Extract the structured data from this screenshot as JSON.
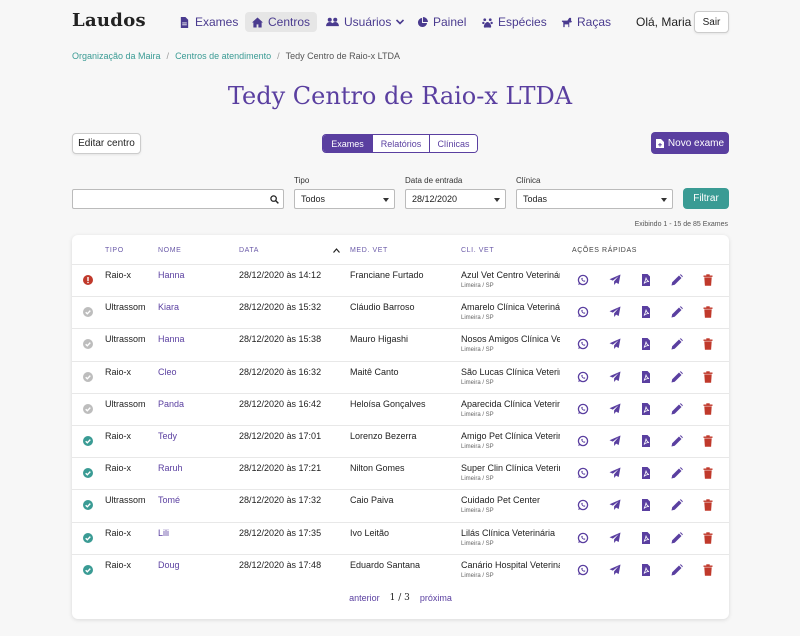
{
  "brand": "Laudos",
  "nav": [
    {
      "label": "Exames",
      "icon": "file-icon"
    },
    {
      "label": "Centros",
      "icon": "home-icon",
      "active": true
    },
    {
      "label": "Usuários",
      "icon": "users-icon",
      "dropdown": true
    },
    {
      "label": "Painel",
      "icon": "chart-pie-icon"
    },
    {
      "label": "Espécies",
      "icon": "paw-icon"
    },
    {
      "label": "Raças",
      "icon": "dog-icon"
    }
  ],
  "greeting": "Olá, Maria",
  "logout_label": "Sair",
  "breadcrumb": {
    "org": "Organização da Maira",
    "centers": "Centros de atendimento",
    "current": "Tedy Centro de Raio-x LTDA"
  },
  "title": "Tedy Centro de Raio-x LTDA",
  "edit_label": "Editar centro",
  "segments": [
    "Exames",
    "Relatórios",
    "Clínicas"
  ],
  "new_exam_label": "Novo exame",
  "filters": {
    "search_value": "",
    "type_label": "Tipo",
    "type_value": "Todos",
    "date_label": "Data de entrada",
    "date_value": "28/12/2020",
    "clinic_label": "Clínica",
    "clinic_value": "Todas",
    "filter_label": "Filtrar"
  },
  "results_count": "Exibindo 1 - 15 de 85 Exames",
  "table": {
    "headers": {
      "type": "TIPO",
      "name": "NOME",
      "date": "DATA",
      "vet": "MED. VET",
      "clinic": "CLI. VET",
      "actions": "AÇÕES RÁPIDAS"
    },
    "rows": [
      {
        "status": "error",
        "type": "Raio-x",
        "name": "Hanna",
        "date": "28/12/2020 às 14:12",
        "vet": "Franciane Furtado",
        "clinic": "Azul Vet Centro Veterinário",
        "location": "Limeira / SP"
      },
      {
        "status": "pending",
        "type": "Ultrassom",
        "name": "Kiara",
        "date": "28/12/2020 às 15:32",
        "vet": "Cláudio Barroso",
        "clinic": "Amarelo Clínica Veterinária",
        "location": "Limeira / SP"
      },
      {
        "status": "pending",
        "type": "Ultrassom",
        "name": "Hanna",
        "date": "28/12/2020 às 15:38",
        "vet": "Mauro Higashi",
        "clinic": "Nosos Amigos Clínica Veterinária",
        "location": "Limeira / SP"
      },
      {
        "status": "pending",
        "type": "Raio-x",
        "name": "Cleo",
        "date": "28/12/2020 às 16:32",
        "vet": "Maitê Canto",
        "clinic": "São Lucas Clínica Veterinária",
        "location": "Limeira / SP"
      },
      {
        "status": "pending",
        "type": "Ultrassom",
        "name": "Panda",
        "date": "28/12/2020 às 16:42",
        "vet": "Heloísa Gonçalves",
        "clinic": "Aparecida Clínica Veterinária",
        "location": "Limeira / SP"
      },
      {
        "status": "done",
        "type": "Raio-x",
        "name": "Tedy",
        "date": "28/12/2020 às 17:01",
        "vet": "Lorenzo Bezerra",
        "clinic": "Amigo Pet Clínica Veterinária",
        "location": "Limeira / SP"
      },
      {
        "status": "done",
        "type": "Raio-x",
        "name": "Raruh",
        "date": "28/12/2020 às 17:21",
        "vet": "Nilton Gomes",
        "clinic": "Super Clin Clínica Veterinária",
        "location": "Limeira / SP"
      },
      {
        "status": "done",
        "type": "Ultrassom",
        "name": "Tomé",
        "date": "28/12/2020 às 17:32",
        "vet": "Caio Paiva",
        "clinic": "Cuidado Pet Center",
        "location": "Limeira / SP"
      },
      {
        "status": "done",
        "type": "Raio-x",
        "name": "Lili",
        "date": "28/12/2020 às 17:35",
        "vet": "Ivo Leitão",
        "clinic": "Lilás Clínica Veterinária",
        "location": "Limeira / SP"
      },
      {
        "status": "done",
        "type": "Raio-x",
        "name": "Doug",
        "date": "28/12/2020 às 17:48",
        "vet": "Eduardo Santana",
        "clinic": "Canário Hospital Veterinário",
        "location": "Limeira / SP"
      }
    ]
  },
  "pager": {
    "prev": "anterior",
    "page": "1 / 3",
    "next": "próxima"
  },
  "colors": {
    "primary": "#5a3fa0",
    "teal": "#3a9b94",
    "danger": "#c0392b",
    "success": "#3a9b94",
    "pending": "#bdbdbd"
  }
}
